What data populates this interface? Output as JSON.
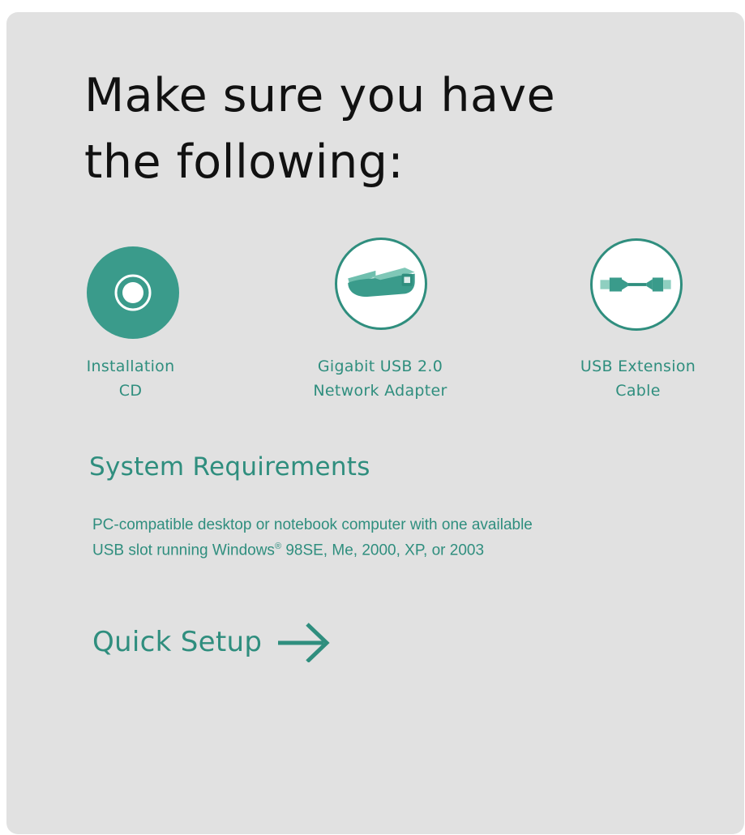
{
  "headline": {
    "line1": "Make sure you have",
    "line2": "the following:"
  },
  "items": [
    {
      "icon": "cd-icon",
      "line1": "Installation",
      "line2": "CD"
    },
    {
      "icon": "usb-adapter-icon",
      "line1": "Gigabit USB 2.0",
      "line2": "Network Adapter"
    },
    {
      "icon": "usb-cable-icon",
      "line1": "USB Extension",
      "line2": "Cable"
    }
  ],
  "requirements": {
    "heading": "System Requirements",
    "line1": "PC-compatible desktop or notebook computer with one available",
    "line2_before": "USB slot running Windows",
    "line2_mark": "®",
    "line2_after": " 98SE, Me, 2000, XP, or 2003"
  },
  "quick_setup": {
    "label": "Quick Setup",
    "icon": "arrow-right-icon"
  },
  "colors": {
    "panel": "#e1e1e1",
    "accent": "#2f8e7e",
    "headline": "#111111"
  }
}
